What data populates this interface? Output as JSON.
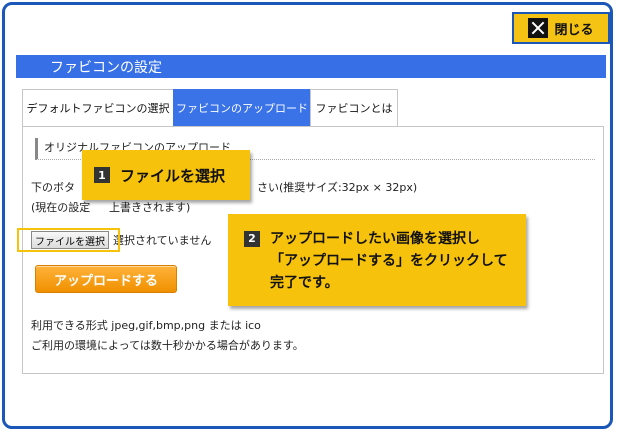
{
  "window": {
    "close_label": "閉じる",
    "title": "ファビコンの設定"
  },
  "tabs": [
    {
      "label": "デフォルトファビコンの選択"
    },
    {
      "label": "ファビコンのアップロード",
      "active": true
    },
    {
      "label": "ファビコンとは"
    }
  ],
  "section": {
    "heading": "オリジナルファビコンのアップロード",
    "desc_line1_left": "下のボタ",
    "desc_line1_right": "さい(推奨サイズ:32px × 32px)",
    "desc_line2_left": "(現在の設定",
    "desc_line2_right": "上書きされます)",
    "file_button": "ファイルを選択",
    "file_status": "選択されていません",
    "upload_button": "アップロードする",
    "formats": "利用できる形式 jpeg,gif,bmp,png または ico",
    "note": "ご利用の環境によっては数十秒かかる場合があります。"
  },
  "callouts": {
    "step1_number": "1",
    "step1_text": "ファイルを選択",
    "step2_number": "2",
    "step2_line1": "アップロードしたい画像を選択し",
    "step2_line2": "「アップロードする」をクリックして",
    "step2_line3": "完了です。"
  },
  "colors": {
    "frame": "#1b57b8",
    "title_bar": "#3770e6",
    "active_tab": "#3a72e8",
    "callout": "#f6c20c",
    "upload_button": "#f09000"
  },
  "icons": {
    "close": "close-icon"
  }
}
